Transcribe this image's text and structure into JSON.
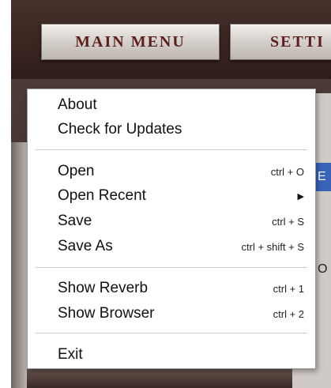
{
  "toolbar": {
    "main_menu_label": "MAIN MENU",
    "settings_label": "SETTI"
  },
  "background": {
    "right_highlight_text": "E",
    "right_dark_text": "O"
  },
  "menu": {
    "groups": [
      [
        {
          "label": "About",
          "shortcut": ""
        },
        {
          "label": "Check for Updates",
          "shortcut": ""
        }
      ],
      [
        {
          "label": "Open",
          "shortcut": "ctrl + O"
        },
        {
          "label": "Open Recent",
          "shortcut": "",
          "submenu": true
        },
        {
          "label": "Save",
          "shortcut": "ctrl + S"
        },
        {
          "label": "Save As",
          "shortcut": "ctrl + shift + S"
        }
      ],
      [
        {
          "label": "Show Reverb",
          "shortcut": "ctrl + 1"
        },
        {
          "label": "Show Browser",
          "shortcut": "ctrl + 2"
        }
      ],
      [
        {
          "label": "Exit",
          "shortcut": ""
        }
      ]
    ]
  },
  "icons": {
    "submenu_arrow": "caret-right-icon"
  },
  "colors": {
    "plate_text": "#5a1f1c",
    "highlight": "#3a64b8"
  }
}
